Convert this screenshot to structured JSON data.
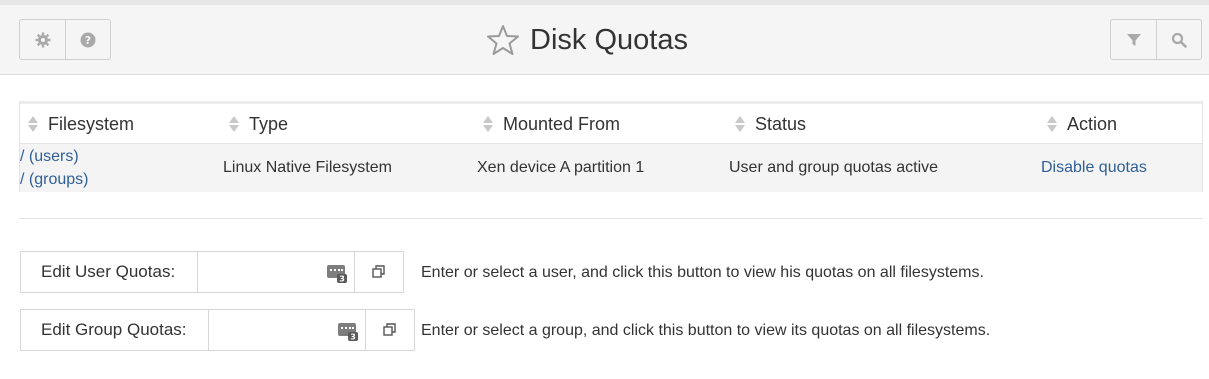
{
  "header": {
    "title": "Disk Quotas",
    "left_buttons": [
      {
        "icon": "gear-icon"
      },
      {
        "icon": "question-circle-icon"
      }
    ],
    "right_buttons": [
      {
        "icon": "filter-icon"
      },
      {
        "icon": "search-icon"
      }
    ],
    "star_icon": "star-outline-icon"
  },
  "table": {
    "columns": [
      "Filesystem",
      "Type",
      "Mounted From",
      "Status",
      "Action"
    ],
    "rows": [
      {
        "filesystem_links": [
          "/ (users)",
          "/ (groups)"
        ],
        "type": "Linux Native Filesystem",
        "mounted_from": "Xen device A partition 1",
        "status": "User and group quotas active",
        "action": "Disable quotas"
      }
    ]
  },
  "user_quota": {
    "label": "Edit User Quotas:",
    "value": "",
    "description": "Enter or select a user, and click this button to view his quotas on all filesystems."
  },
  "group_quota": {
    "label": "Edit Group Quotas:",
    "value": "",
    "description": "Enter or select a group, and click this button to view its quotas on all filesystems."
  },
  "colors": {
    "link": "#2f5f96",
    "header_bg": "#f5f5f5",
    "row_bg": "#f4f4f4"
  }
}
